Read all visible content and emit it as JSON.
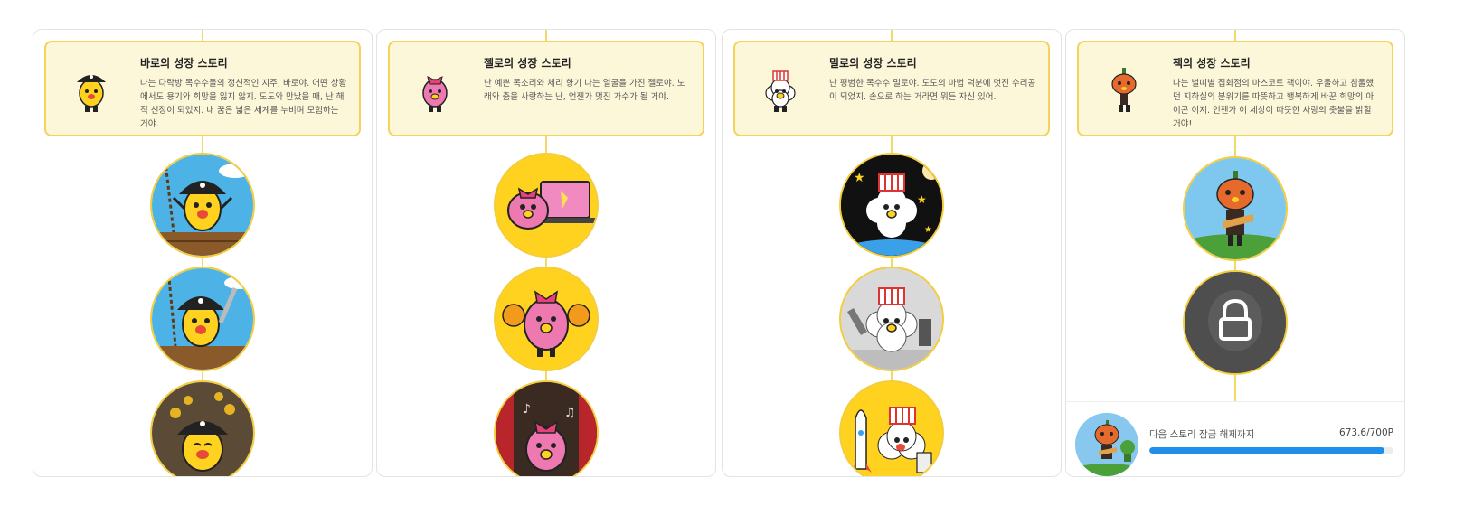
{
  "panels": [
    {
      "title": "바로의 성장 스토리",
      "description": "나는 다락방 목수수들의 정신적인 지주, 바로야. 어떤 상황에서도 용기와 희망을 잃지 않지. 도도와 만났을 때, 난 해적 선장이 되었지. 내 꿈은 넓은 세계를 누비며 모험하는 거야."
    },
    {
      "title": "젤로의 성장 스토리",
      "description": "난 예쁜 목소리와 체리 향기 나는 얼굴을 가진 젤로야. 노래와 춤을 사랑하는 난, 언젠가 멋진 가수가 될 거야."
    },
    {
      "title": "밀로의 성장 스토리",
      "description": "난 평범한 목수수 밀로야. 도도의 마법 덕분에 멋진 수리공이 되었지. 손으로 하는 거라면 뭐든 자신 있어."
    },
    {
      "title": "잭의 성장 스토리",
      "description": "나는 벌띠별 집화점의 마스코트 잭이야. 우울하고 침울했던 지하실의 분위기를 따뜻하고 행복하게 바꾼 희망의 아이콘 이지. 언젠가 이 세상이 따뜻한 사랑의 촛불을 밝힐 거야!"
    }
  ],
  "unlock": {
    "label": "다음 스토리 잠금 해제까지",
    "points": "673.6/700P",
    "progress": 0.962
  },
  "colors": {
    "card_bg": "#fdf7d9",
    "card_border": "#f3d35a",
    "progress": "#1f8fea",
    "circle_yellow": "#ffd21f",
    "sky_blue": "#4db3e6"
  }
}
